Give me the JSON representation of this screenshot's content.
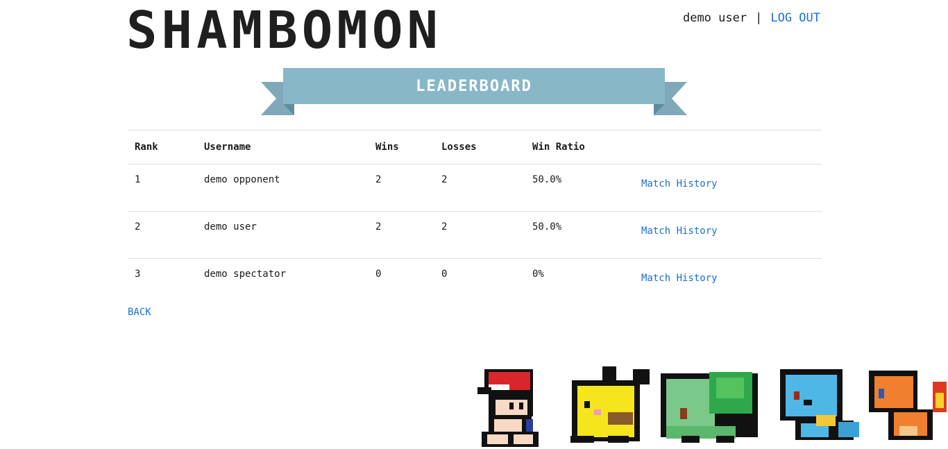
{
  "app": {
    "logo": "SHAMBOMON"
  },
  "user": {
    "name": "demo user",
    "separator": "|",
    "logout_label": "LOG OUT"
  },
  "banner": {
    "title": "LEADERBOARD"
  },
  "table": {
    "headers": {
      "rank": "Rank",
      "username": "Username",
      "wins": "Wins",
      "losses": "Losses",
      "win_ratio": "Win Ratio"
    },
    "rows": [
      {
        "rank": "1",
        "username": "demo opponent",
        "wins": "2",
        "losses": "2",
        "win_ratio": "50.0%",
        "link": "Match History"
      },
      {
        "rank": "2",
        "username": "demo user",
        "wins": "2",
        "losses": "2",
        "win_ratio": "50.0%",
        "link": "Match History"
      },
      {
        "rank": "3",
        "username": "demo spectator",
        "wins": "0",
        "losses": "0",
        "win_ratio": "0%",
        "link": "Match History"
      }
    ]
  },
  "nav": {
    "back_label": "BACK"
  },
  "decor": {
    "sprites": [
      "trainer-sprite",
      "pikachu-sprite",
      "bulbasaur-sprite",
      "squirtle-sprite",
      "charmander-sprite"
    ],
    "colors": {
      "banner": "#88b7c8",
      "banner_fold": "#6a9aab",
      "link": "#1a6fd6"
    }
  }
}
